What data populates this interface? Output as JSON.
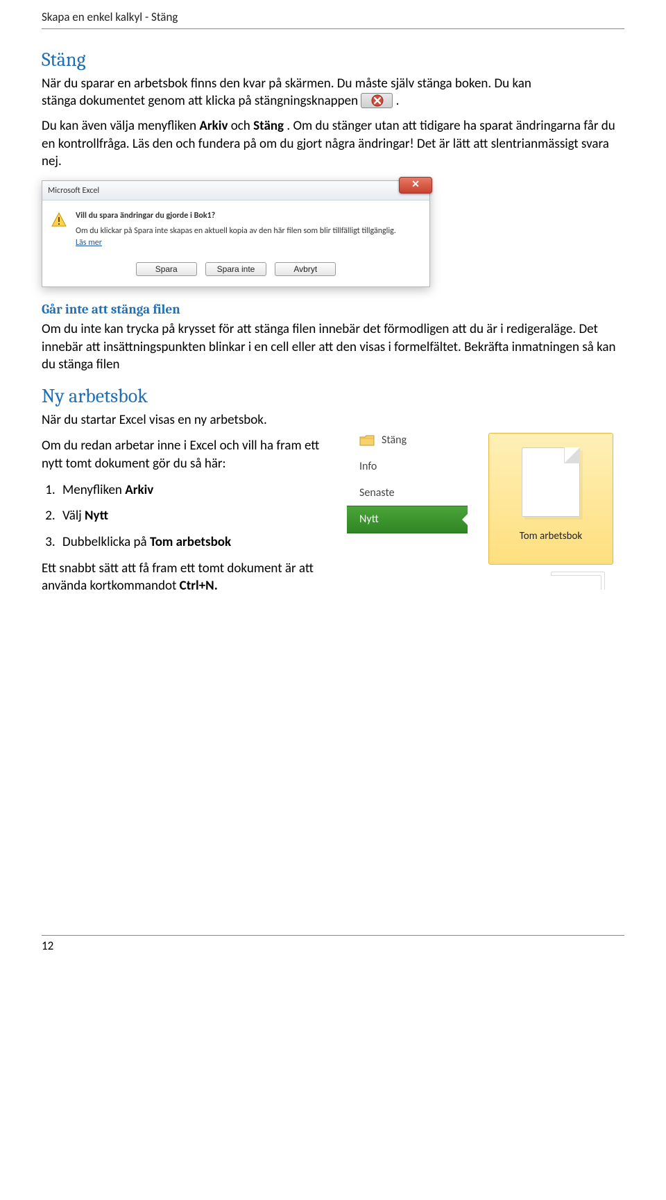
{
  "header": "Skapa en enkel kalkyl - Stäng",
  "sec1_title": "Stäng",
  "p1a": "När du sparar en arbetsbok finns den kvar på skärmen. Du måste själv stänga boken. Du kan",
  "p1b": "stänga dokumentet genom att klicka på stängningsknappen ",
  "p1c_before": "Du kan även välja menyfliken ",
  "p1c_bold1": "Arkiv",
  "p1c_mid": " och ",
  "p1c_bold2": "Stäng",
  "p1c_after": ". Om du stänger utan att tidigare ha sparat ändringarna får du en kontrollfråga. Läs den och fundera på om du gjort några ändringar! Det är lätt att slentrianmässigt svara nej.",
  "dialog": {
    "title": "Microsoft Excel",
    "msg": "Vill du spara ändringar du gjorde i Bok1?",
    "sub": "Om du klickar på Spara inte skapas en aktuell kopia av den här filen som blir tillfälligt tillgänglig.",
    "link": "Läs mer",
    "btn_save": "Spara",
    "btn_dontsave": "Spara inte",
    "btn_cancel": "Avbryt"
  },
  "sub1_title": "Går inte att stänga filen",
  "sub1_text": "Om du inte kan trycka på krysset för att stänga filen innebär det förmodligen att du är i redigeraläge. Det innebär att insättningspunkten blinkar i en cell eller att den visas i formelfältet. Bekräfta inmatningen så kan du stänga filen",
  "sec2_title": "Ny arbetsbok",
  "sec2_intro": "När du startar Excel visas en ny arbetsbok.",
  "sec2_left": "Om du redan arbetar inne i Excel och vill ha fram ett nytt tomt dokument gör du så här:",
  "steps": {
    "s1a": "Menyfliken ",
    "s1b": "Arkiv",
    "s2a": "Välj ",
    "s2b": "Nytt",
    "s3a": "Dubbelklicka på ",
    "s3b": "Tom arbetsbok"
  },
  "shortcut_a": "Ett snabbt sätt att få fram ett tomt dokument är att använda kortkommandot ",
  "shortcut_b": "Ctrl+N.",
  "nav": {
    "close": "Stäng",
    "info": "Info",
    "recent": "Senaste",
    "new": "Nytt"
  },
  "tile_label": "Tom arbetsbok",
  "page_number": "12"
}
